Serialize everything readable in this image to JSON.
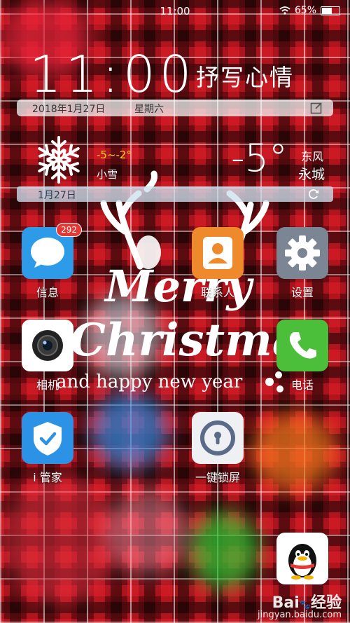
{
  "status_bar": {
    "time": "11:00",
    "battery": "65%",
    "battery_level": 0.65
  },
  "clock_widget": {
    "time": "11:00",
    "mood_prompt": "抒写心情",
    "date": "2018年1月27日",
    "weekday": "星期六"
  },
  "weather_widget": {
    "temp_range": "-5~-2°",
    "condition": "小雪",
    "current_temp": "-5°",
    "wind": "东风",
    "city": "永城",
    "day_label": "1月27日",
    "icon": "snowflake-icon"
  },
  "wallpaper": {
    "line1": "Merry",
    "line2": "Christmas",
    "line3": "and happy new year"
  },
  "apps": [
    {
      "label": "信息",
      "icon": "message-icon",
      "badge": "292",
      "color": "#2e9be8"
    },
    {
      "label": "联系人",
      "icon": "contacts-icon",
      "color": "#ef8a2c"
    },
    {
      "label": "设置",
      "icon": "gear-icon",
      "color": "#7b8594"
    },
    {
      "label": "相机",
      "icon": "camera-icon",
      "color": "#ffffff"
    },
    {
      "label": "电话",
      "icon": "phone-icon",
      "color": "#4cbf3a"
    },
    {
      "label": "i 管家",
      "icon": "shield-icon",
      "color": "#2c92e6"
    },
    {
      "label": "一键锁屏",
      "icon": "lock-icon",
      "color": "#eef0f4"
    },
    {
      "label": "",
      "icon": "qq-penguin-icon",
      "color": "#ffffff"
    }
  ],
  "watermark": {
    "brand": "Bai",
    "brand2": "经验",
    "url": "jingyan.baidu.com"
  }
}
